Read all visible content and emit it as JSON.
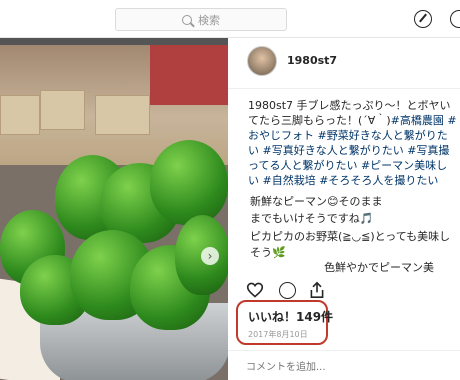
{
  "nav": {
    "search_placeholder": "検索",
    "icons": [
      "search-icon",
      "compass-icon"
    ]
  },
  "post": {
    "username": "1980st7",
    "caption_user": "1980st7",
    "caption_text": " 手ブレ感たっぷり〜！とボヤいてたら三脚もらった！(´∀｀)",
    "caption_tags": "#高橋農園 #おやじフォト #野菜好きな人と繋がりたい #写真好きな人と繋がりたい #写真撮ってる人と繋がりたい #ピーマン美味しい #自然栽培 #そろそろ人を撮りたい",
    "comments": [
      "新鮮なピーマン😊そのまま",
      "までもいけそうですね🎵",
      "ピカピカのお野菜(≧◡≦)とっても美味しそう🌿",
      "色鮮やかでピーマン美"
    ],
    "likes": "いいね！149件",
    "date": "2017年8月10日",
    "add_comment_placeholder": "コメントを追加..."
  },
  "colors": {
    "annotation_ring": "#c0392b",
    "hashtag": "#003569"
  }
}
